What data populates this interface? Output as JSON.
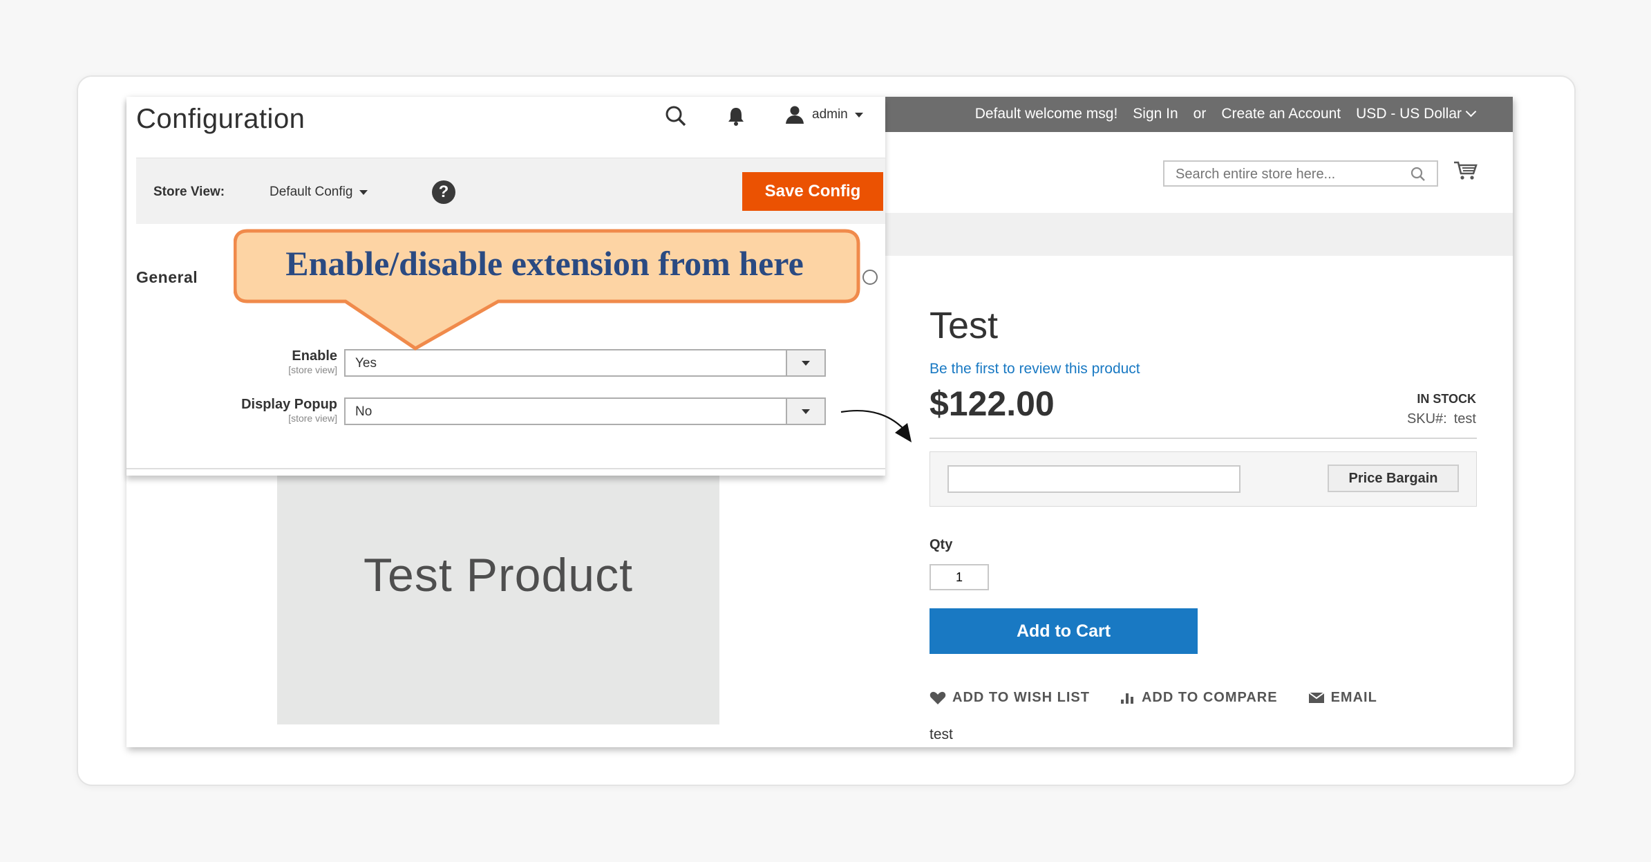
{
  "storefront": {
    "topbar": {
      "welcome": "Default welcome msg!",
      "sign_in": "Sign In",
      "or": "or",
      "create_account": "Create an Account",
      "currency": "USD - US Dollar"
    },
    "search": {
      "placeholder": "Search entire store here..."
    },
    "product": {
      "image_label": "Test Product",
      "title": "Test",
      "review_link": "Be the first to review this product",
      "price": "$122.00",
      "stock": "IN STOCK",
      "sku_label": "SKU#:",
      "sku_value": "test",
      "bargain_button": "Price Bargain",
      "qty_label": "Qty",
      "qty_value": "1",
      "add_to_cart": "Add to Cart",
      "actions": {
        "wishlist": "ADD TO WISH LIST",
        "compare": "ADD TO COMPARE",
        "email": "EMAIL"
      },
      "description": "test"
    }
  },
  "admin": {
    "title": "Configuration",
    "user": "admin",
    "store_view_label": "Store View:",
    "store_view_value": "Default Config",
    "help": "?",
    "save_config": "Save Config",
    "section": "General",
    "fields": [
      {
        "label": "Enable",
        "scope": "[store view]",
        "value": "Yes"
      },
      {
        "label": "Display Popup",
        "scope": "[store view]",
        "value": "No"
      }
    ]
  },
  "callout": {
    "text": "Enable/disable extension from here"
  },
  "colors": {
    "accent_orange": "#eb5202",
    "primary_blue": "#1979c3",
    "callout_fill": "#fdd4a4",
    "callout_border": "#f08a4b",
    "callout_text": "#2a4a82",
    "topbar": "#6d6d6d"
  }
}
